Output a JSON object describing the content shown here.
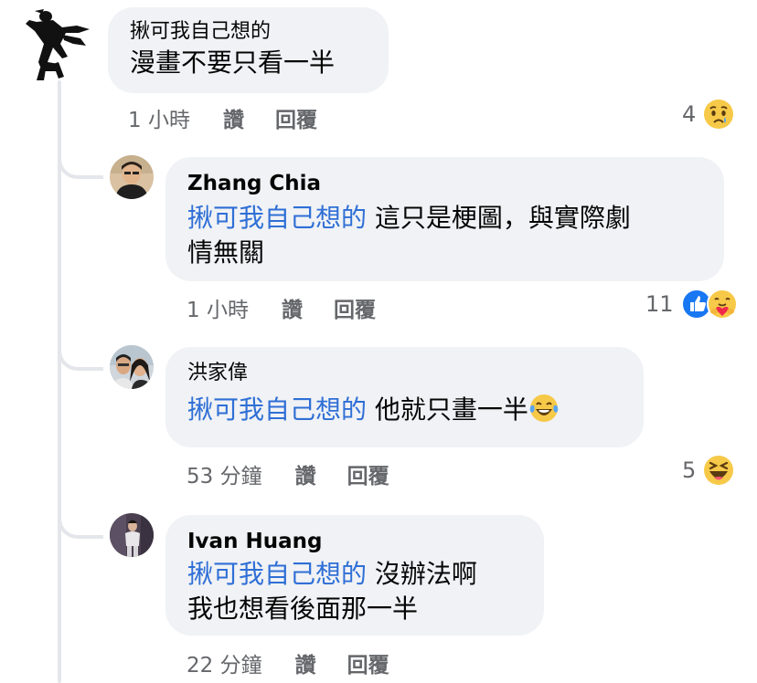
{
  "comments": [
    {
      "author": "揪可我自己想的",
      "lines": [
        "漫畫不要只看一半"
      ],
      "time": "1 小時",
      "like_label": "讚",
      "reply_label": "回覆",
      "reaction_count": "4",
      "reaction_icons": [
        "sad-icon"
      ]
    }
  ],
  "replies": [
    {
      "author": "Zhang Chia",
      "mention": "揪可我自己想的",
      "text_line1": "這只是梗圖，與實際劇",
      "text_line2": "情無關",
      "time": "1 小時",
      "like_label": "讚",
      "reply_label": "回覆",
      "reaction_count": "11",
      "reaction_icons": [
        "like-icon",
        "care-icon"
      ]
    },
    {
      "author": "洪家偉",
      "mention": "揪可我自己想的",
      "text_line1": "他就只畫一半",
      "inline_emoji": "laugh-tears-icon",
      "time": "53 分鐘",
      "like_label": "讚",
      "reply_label": "回覆",
      "reaction_count": "5",
      "reaction_icons": [
        "haha-icon"
      ]
    },
    {
      "author": "Ivan Huang",
      "mention": "揪可我自己想的",
      "text_line1": "沒辦法啊",
      "text_line2": "我也想看後面那一半",
      "time": "22 分鐘",
      "like_label": "讚",
      "reply_label": "回覆"
    }
  ]
}
